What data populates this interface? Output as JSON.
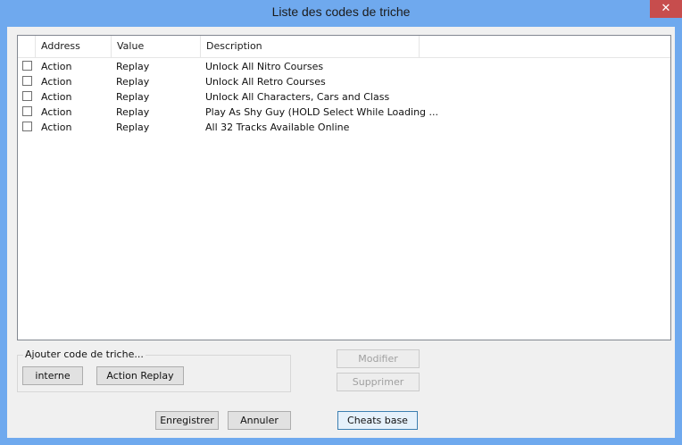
{
  "window": {
    "title": "Liste des codes de triche",
    "close_glyph": "✕"
  },
  "list": {
    "columns": [
      "Address",
      "Value",
      "Description"
    ],
    "rows": [
      {
        "address": "Action",
        "value": "Replay",
        "description": "Unlock All Nitro Courses",
        "checked": false
      },
      {
        "address": "Action",
        "value": "Replay",
        "description": "Unlock All Retro Courses",
        "checked": false
      },
      {
        "address": "Action",
        "value": "Replay",
        "description": "Unlock All Characters, Cars and Class",
        "checked": false
      },
      {
        "address": "Action",
        "value": "Replay",
        "description": "Play As Shy Guy (HOLD Select While Loading ...",
        "checked": false
      },
      {
        "address": "Action",
        "value": "Replay",
        "description": "All 32 Tracks Available Online",
        "checked": false
      }
    ]
  },
  "add_group": {
    "label": "Ajouter code de triche...",
    "internal_label": "interne",
    "action_replay_label": "Action Replay"
  },
  "edit": {
    "modify_label": "Modifier",
    "delete_label": "Supprimer"
  },
  "footer": {
    "save_label": "Enregistrer",
    "cancel_label": "Annuler",
    "cheats_base_label": "Cheats base"
  },
  "colors": {
    "title_bar": "#6fa9ee",
    "close_button": "#c74d4d"
  }
}
